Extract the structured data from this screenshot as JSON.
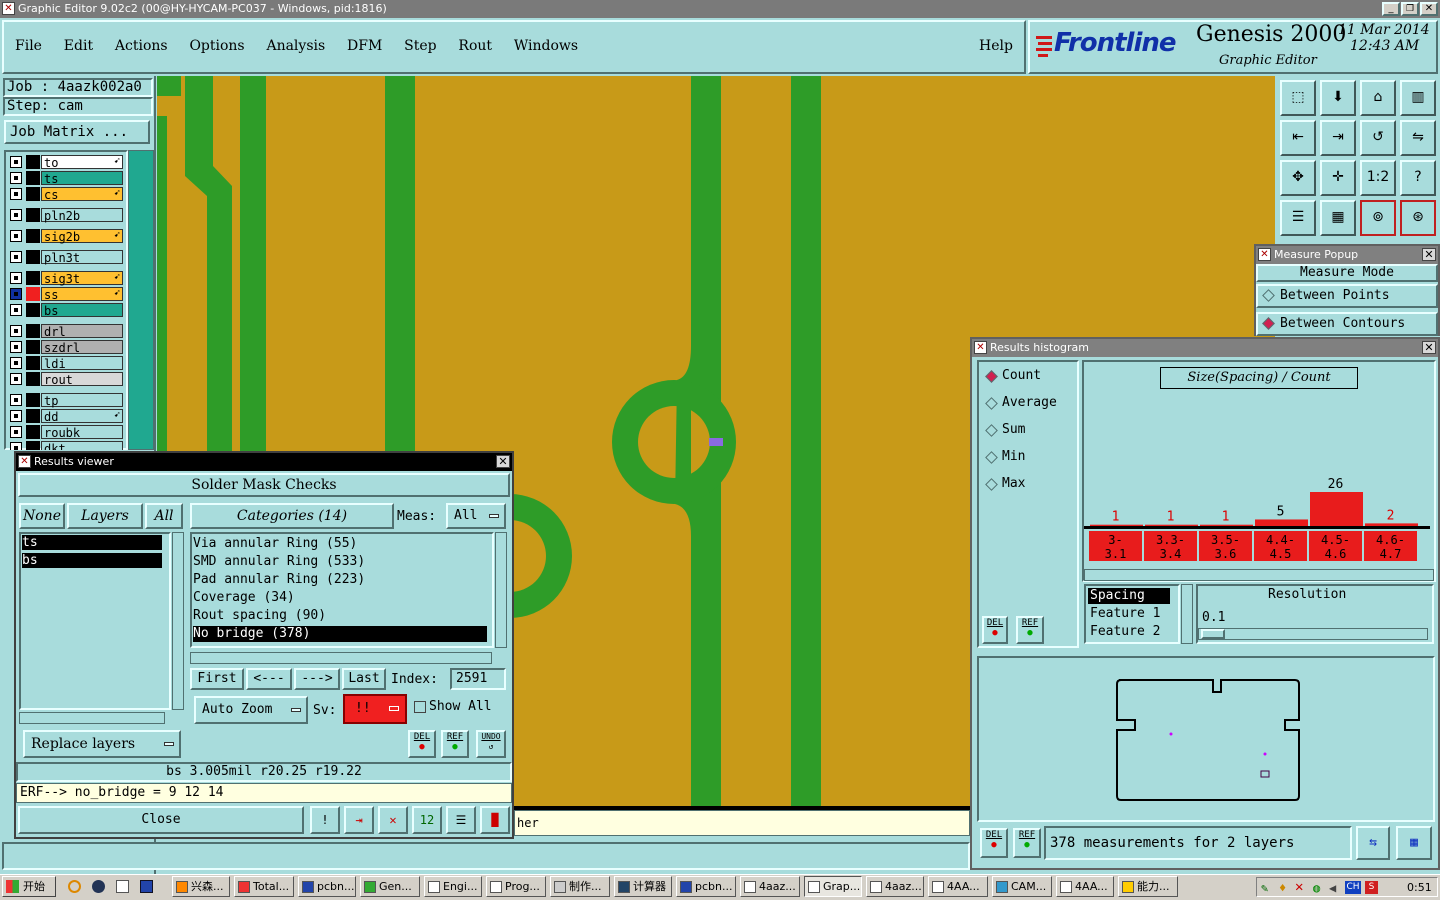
{
  "window": {
    "title": "Graphic Editor 9.02c2 (00@HY-HYCAM-PC037 - Windows, pid:1816)"
  },
  "menu": [
    "File",
    "Edit",
    "Actions",
    "Options",
    "Analysis",
    "DFM",
    "Step",
    "Rout",
    "Windows"
  ],
  "help": "Help",
  "brand": {
    "logo": "Frontline",
    "product": "Genesis 2000",
    "subtitle": "Graphic Editor",
    "date": "11 Mar 2014",
    "time": "12:43 AM"
  },
  "job": {
    "job": "Job : 4aazk002a0",
    "step": "Step: cam",
    "matrix": "Job Matrix ..."
  },
  "layers": [
    {
      "name": "to",
      "color": "#ffffff",
      "mark": "arrow"
    },
    {
      "name": "ts",
      "color": "#20a890",
      "mark": ""
    },
    {
      "name": "cs",
      "color": "#ffc030",
      "mark": "arrow"
    },
    {
      "name": "pln2b",
      "color": "#a8dcdc",
      "mark": ""
    },
    {
      "name": "sig2b",
      "color": "#ffc030",
      "mark": "arrow"
    },
    {
      "name": "pln3t",
      "color": "#a8dcdc",
      "mark": ""
    },
    {
      "name": "sig3t",
      "color": "#ffc030",
      "mark": "arrow"
    },
    {
      "name": "ss",
      "color": "#ffc030",
      "mark": "arrow"
    },
    {
      "name": "bs",
      "color": "#20a890",
      "mark": ""
    },
    {
      "name": "drl",
      "color": "#b0b0b0",
      "mark": ""
    },
    {
      "name": "szdrl",
      "color": "#b0b0b0",
      "mark": ""
    },
    {
      "name": "ldi",
      "color": "#a8dcdc",
      "mark": ""
    },
    {
      "name": "rout",
      "color": "#d8d8d8",
      "mark": ""
    },
    {
      "name": "tp",
      "color": "#a8dcdc",
      "mark": ""
    },
    {
      "name": "dd",
      "color": "#a8dcdc",
      "mark": "arrow"
    },
    {
      "name": "roubk",
      "color": "#a8dcdc",
      "mark": ""
    },
    {
      "name": "dkt",
      "color": "#a8dcdc",
      "mark": ""
    }
  ],
  "results_viewer": {
    "title": "Results viewer",
    "header": "Solder Mask Checks",
    "none": "None",
    "layers_btn": "Layers",
    "all_btn": "All",
    "layer_list": [
      "ts",
      "bs"
    ],
    "categories_btn": "Categories (14)",
    "meas_label": "Meas:",
    "meas_value": "All",
    "categories": [
      "Via annular Ring (55)",
      "SMD annular Ring (533)",
      "Pad annular Ring (223)",
      "Coverage (34)",
      "Rout spacing (90)",
      "No bridge (378)"
    ],
    "first": "First",
    "prev": "<---",
    "next": "--->",
    "last": "Last",
    "index_label": "Index:",
    "index_value": "2591",
    "auto_zoom": "Auto Zoom",
    "sv_label": "Sv:",
    "sv_value": "!!",
    "show_all": "Show All",
    "replace_layers": "Replace layers",
    "del": "DEL",
    "ref": "REF",
    "undo": "UNDO",
    "status1": "bs 3.005mil  r20.25  r19.22",
    "status2": "ERF--> no_bridge = 9 12 14",
    "close": "Close",
    "partial": "her"
  },
  "measure": {
    "title": "Measure Popup",
    "mode": "Measure Mode",
    "options": [
      "Between Points",
      "Between Contours"
    ],
    "selected": 1
  },
  "histogram": {
    "title": "Results histogram",
    "options": [
      "Count",
      "Average",
      "Sum",
      "Min",
      "Max"
    ],
    "selected": 0,
    "chart_title": "Size(Spacing) / Count",
    "counts": [
      "1",
      "1",
      "1",
      "5",
      "26",
      "2"
    ],
    "bins": [
      "3-\n3.1",
      "3.3-\n3.4",
      "3.5-\n3.6",
      "4.4-\n4.5",
      "4.5-\n4.6",
      "4.6-\n4.7"
    ],
    "list": [
      "Spacing",
      "Feature 1",
      "Feature 2"
    ],
    "resolution_label": "Resolution",
    "resolution_value": "0.1",
    "status": "378 measurements for 2 layers",
    "del": "DEL",
    "ref": "REF"
  },
  "chart_data": {
    "type": "bar",
    "title": "Size(Spacing) / Count",
    "categories": [
      "3-3.1",
      "3.3-3.4",
      "3.5-3.6",
      "4.4-4.5",
      "4.5-4.6",
      "4.6-4.7"
    ],
    "values": [
      1,
      1,
      1,
      5,
      26,
      2
    ],
    "ylim": [
      0,
      26
    ]
  },
  "taskbar": {
    "start": "开始",
    "items": [
      "兴森...",
      "Total...",
      "pcbn...",
      "Gen...",
      "Engi...",
      "Prog...",
      "制作...",
      "计算器",
      "pcbn...",
      "4aaz...",
      "Grap...",
      "4aaz...",
      "4AA...",
      "CAM...",
      "4AA...",
      "能力..."
    ],
    "clock": "0:51"
  },
  "colors": {
    "panel": "#a8dcdc",
    "board": "#c89a18",
    "trace": "#2e9c28",
    "hist_bar": "#e81c1c"
  }
}
